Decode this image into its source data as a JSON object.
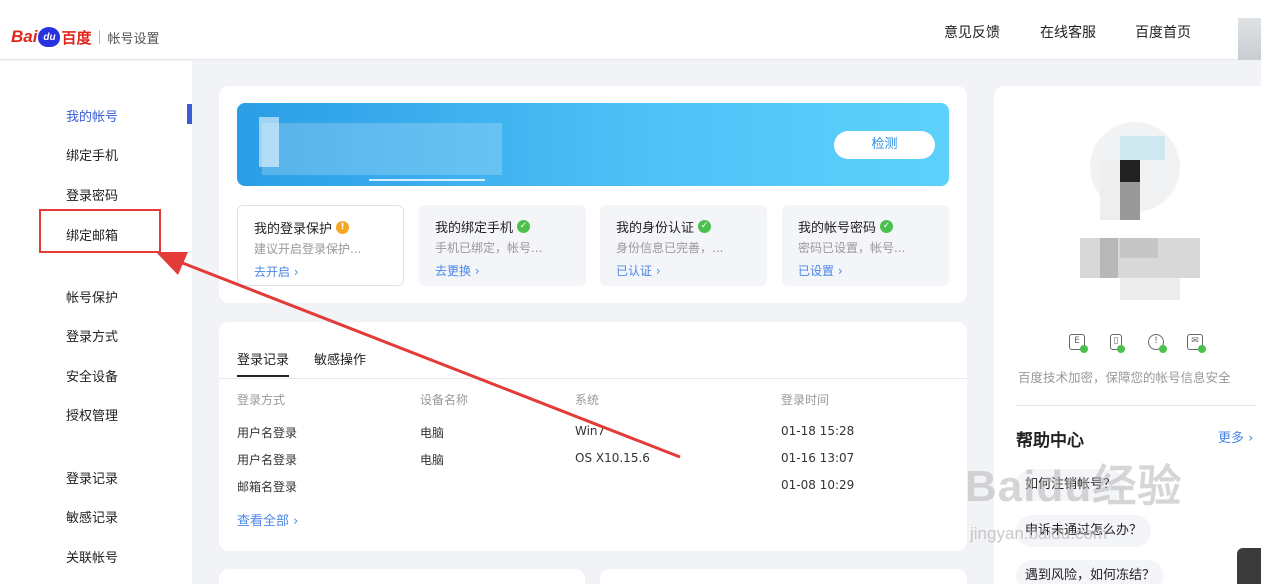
{
  "header": {
    "logo_bai": "Bai",
    "logo_du": "du",
    "logo_cn": "百度",
    "subtitle": "帐号设置",
    "nav": [
      "意见反馈",
      "在线客服",
      "百度首页"
    ]
  },
  "sidebar": {
    "items": [
      {
        "label": "我的帐号",
        "active": true
      },
      {
        "label": "绑定手机"
      },
      {
        "label": "登录密码"
      },
      {
        "label": "绑定邮箱",
        "highlighted": true
      },
      {
        "label": "帐号保护"
      },
      {
        "label": "登录方式"
      },
      {
        "label": "安全设备"
      },
      {
        "label": "授权管理"
      },
      {
        "label": "登录记录"
      },
      {
        "label": "敏感记录"
      },
      {
        "label": "关联帐号"
      }
    ]
  },
  "banner": {
    "detect_label": "检测"
  },
  "security_cards": [
    {
      "title": "我的登录保护",
      "status": "warning",
      "desc": "建议开启登录保护...",
      "link": "去开启 ›"
    },
    {
      "title": "我的绑定手机",
      "status": "ok",
      "desc": "手机已绑定，帐号...",
      "link": "去更换 ›"
    },
    {
      "title": "我的身份认证",
      "status": "ok",
      "desc": "身份信息已完善，...",
      "link": "已认证 ›"
    },
    {
      "title": "我的帐号密码",
      "status": "ok",
      "desc": "密码已设置，帐号...",
      "link": "已设置 ›"
    }
  ],
  "records": {
    "tabs": [
      "登录记录",
      "敏感操作"
    ],
    "columns": [
      "登录方式",
      "设备名称",
      "系统",
      "登录时间"
    ],
    "rows": [
      [
        "用户名登录",
        "电脑",
        "Win7",
        "01-18 15:28"
      ],
      [
        "用户名登录",
        "电脑",
        "OS X10.15.6",
        "01-16 13:07"
      ],
      [
        "邮箱名登录",
        "",
        "",
        "01-08 10:29"
      ]
    ],
    "view_all": "查看全部 ›"
  },
  "profile": {
    "encrypt_text": "百度技术加密，保障您的帐号信息安全"
  },
  "help": {
    "title": "帮助中心",
    "more": "更多 ›",
    "questions": [
      "如何注销帐号？",
      "申诉未通过怎么办？",
      "遇到风险，如何冻结？"
    ]
  },
  "watermark": {
    "main": "Baidu经验",
    "sub": "jingyan.baidu.com"
  },
  "colors": {
    "accent": "#3b5cd6",
    "link": "#4a86e8",
    "annotation_red": "#e23b38",
    "ok_green": "#4cc04c",
    "warn_orange": "#f5a623"
  }
}
